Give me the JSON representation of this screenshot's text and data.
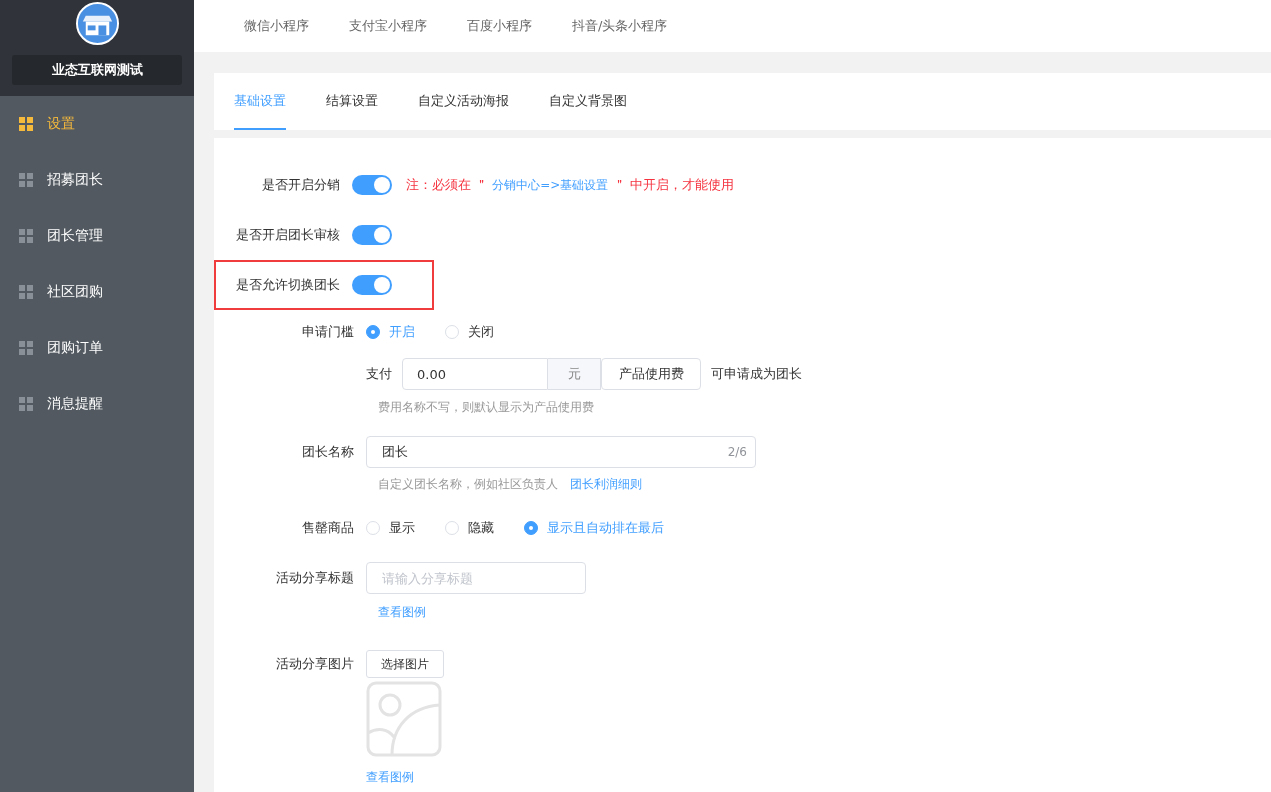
{
  "sidebar": {
    "shop_name": "业态互联网测试",
    "items": [
      {
        "label": "设置",
        "selected": true
      },
      {
        "label": "招募团长",
        "selected": false
      },
      {
        "label": "团长管理",
        "selected": false
      },
      {
        "label": "社区团购",
        "selected": false
      },
      {
        "label": "团购订单",
        "selected": false
      },
      {
        "label": "消息提醒",
        "selected": false
      }
    ]
  },
  "top_tabs": [
    {
      "label": "微信小程序",
      "selected": false
    },
    {
      "label": "支付宝小程序",
      "selected": false
    },
    {
      "label": "百度小程序",
      "selected": false
    },
    {
      "label": "抖音/头条小程序",
      "selected": false
    }
  ],
  "settings_tabs": [
    {
      "label": "基础设置",
      "selected": true
    },
    {
      "label": "结算设置",
      "selected": false
    },
    {
      "label": "自定义活动海报",
      "selected": false
    },
    {
      "label": "自定义背景图",
      "selected": false
    }
  ],
  "switches": [
    {
      "label": "是否开启分销",
      "on": true,
      "highlighted": false,
      "note": {
        "prefix": "注：必须在 ＂",
        "link": "分销中心=>基础设置",
        "suffix": "＂ 中开启，才能使用"
      }
    },
    {
      "label": "是否开启团长审核",
      "on": true,
      "highlighted": false
    },
    {
      "label": "是否允许切换团长",
      "on": true,
      "highlighted": true
    }
  ],
  "threshold": {
    "label": "申请门槛",
    "options": [
      {
        "label": "开启",
        "selected": true
      },
      {
        "label": "关闭",
        "selected": false
      }
    ],
    "pay_label": "支付",
    "amount": "0.00",
    "unit": "元",
    "fee_name": "产品使用费",
    "suffix": "可申请成为团长",
    "hint": "费用名称不写，则默认显示为产品使用费"
  },
  "leader_name": {
    "label": "团长名称",
    "value": "团长",
    "counter": "2/6",
    "hint": "自定义团长名称，例如社区负责人",
    "link": "团长利润细则"
  },
  "sold_out": {
    "label": "售罄商品",
    "options": [
      {
        "label": "显示",
        "selected": false
      },
      {
        "label": "隐藏",
        "selected": false
      },
      {
        "label": "显示且自动排在最后",
        "selected": true
      }
    ]
  },
  "share_title": {
    "label": "活动分享标题",
    "placeholder": "请输入分享标题",
    "link": "查看图例"
  },
  "share_image": {
    "label": "活动分享图片",
    "button": "选择图片",
    "link": "查看图例"
  }
}
